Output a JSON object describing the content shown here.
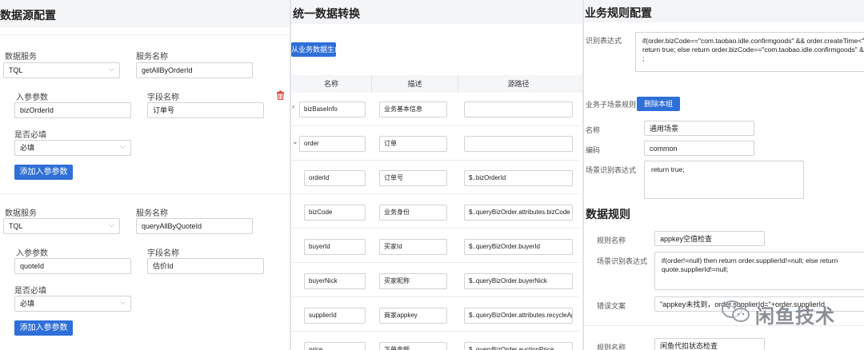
{
  "left": {
    "title": "数据源配置",
    "groups": [
      {
        "service_label": "数据服务",
        "service_value": "TQL",
        "service_name_label": "服务名称",
        "service_name_value": "getAllByOrderId",
        "param_label": "入参参数",
        "param_value": "bizOrderId",
        "field_label": "字段名称",
        "field_value": "订单号",
        "required_label": "是否必填",
        "required_value": "必填",
        "add_button": "添加入参参数"
      },
      {
        "service_label": "数据服务",
        "service_value": "TQL",
        "service_name_label": "服务名称",
        "service_name_value": "queryAllByQuoteId",
        "param_label": "入参参数",
        "param_value": "quoteId",
        "field_label": "字段名称",
        "field_value": "估价Id",
        "required_label": "是否必填",
        "required_value": "必填",
        "add_button": "添加入参参数"
      }
    ]
  },
  "middle": {
    "title": "统一数据转换",
    "generate_button": "从业务数据生成",
    "headers": [
      "名称",
      "描述",
      "源路径"
    ],
    "rows": [
      {
        "name": "bizBaseInfo",
        "desc": "业务基本信息",
        "path": "",
        "arrow": "›"
      },
      {
        "name": "order",
        "desc": "订单",
        "path": "",
        "arrow": "⌄"
      },
      {
        "name": "orderId",
        "desc": "订单号",
        "path": "$..bizOrderId",
        "arrow": ""
      },
      {
        "name": "bizCode",
        "desc": "业务身份",
        "path": "$..queryBizOrder.attributes.bizCode",
        "arrow": ""
      },
      {
        "name": "buyerId",
        "desc": "买家Id",
        "path": "$..queryBizOrder.buyerId",
        "arrow": ""
      },
      {
        "name": "buyerNick",
        "desc": "买家昵称",
        "path": "$..queryBizOrder.buyerNick",
        "arrow": ""
      },
      {
        "name": "supplierId",
        "desc": "商家appkey",
        "path": "$..queryBizOrder.attributes.recycleAppKey",
        "arrow": ""
      },
      {
        "name": "price",
        "desc": "下单金额",
        "path": "$..queryBizOrder.auctionPrice",
        "arrow": ""
      }
    ]
  },
  "right": {
    "title": "业务规则配置",
    "recognize_label": "识别表达式",
    "recognize_expr": "if(order.bizCode==\"com.taobao.idle.confirmgoods\" && order.createTime<\"2019-\nreturn true; else return order.bizCode==\"com.taobao.idle.confirmgoods\" && bizE\n;",
    "sub_label": "业务子场景规则",
    "delete_button": "删除本组",
    "name_label": "名称",
    "name_value": "通用场景",
    "code_label": "编码",
    "code_value": "common",
    "scene_label": "场景识别表达式",
    "scene_expr": "return true;",
    "rules_title": "数据规则",
    "rule1": {
      "name_label": "规则名称",
      "name_value": "appkey空值检查",
      "expr_label": "场景识别表达式",
      "expr_value": "if(order!=null) then return order.supplierId!=null; else return\nquote.supplierId!=null;",
      "err_label": "错误文案",
      "err_value": "\"appkey未找到，order.supplierId=\"+order.supplierId"
    },
    "rule2": {
      "name_label": "规则名称",
      "name_value": "闲鱼代扣状态检查"
    }
  },
  "watermark": "闲鱼技术"
}
